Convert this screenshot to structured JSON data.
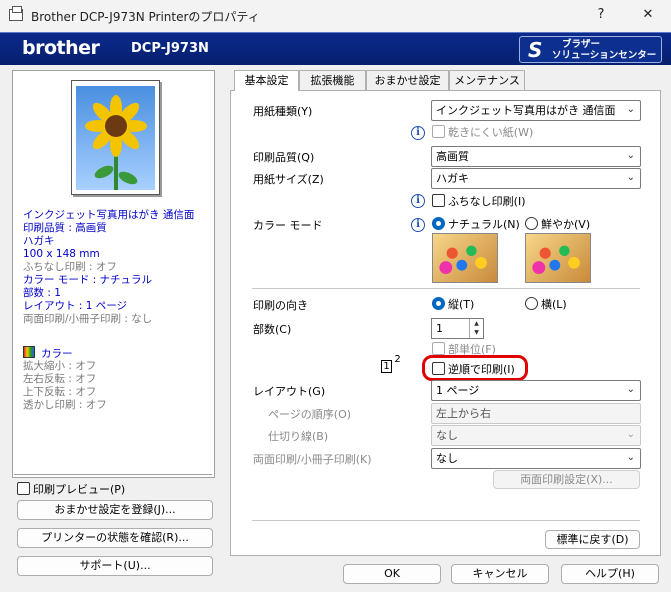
{
  "window": {
    "title": "Brother DCP-J973N Printerのプロパティ",
    "help_glyph": "?",
    "close_glyph": "✕"
  },
  "brand": {
    "logo": "brother",
    "model": "DCP-J973N",
    "solution_line1": "ブラザー",
    "solution_line2": "ソリューションセンター"
  },
  "summary": {
    "blue_lines": [
      "インクジェット写真用はがき 通信面",
      "印刷品質 : 高画質",
      "ハガキ",
      "100 x 148 mm"
    ],
    "gray_lines": [
      "ふちなし印刷 : オフ"
    ],
    "blue_lines2": [
      "カラー モード : ナチュラル",
      "部数 : 1",
      "レイアウト : 1 ページ"
    ],
    "gray_lines2": [
      "両面印刷/小冊子印刷 : なし"
    ],
    "color_label": "カラー",
    "gray_lines3": [
      "拡大縮小 : オフ",
      "左右反転 : オフ",
      "上下反転 : オフ",
      "透かし印刷 : オフ"
    ]
  },
  "left_controls": {
    "print_preview": "印刷プレビュー(P)",
    "register_favorite": "おまかせ設定を登録(J)...",
    "check_status": "プリンターの状態を確認(R)...",
    "support": "サポート(U)..."
  },
  "tabs": [
    "基本設定",
    "拡張機能",
    "おまかせ設定",
    "メンテナンス"
  ],
  "basic": {
    "media_type_label": "用紙種類(Y)",
    "media_type_value": "インクジェット写真用はがき 通信面",
    "slow_drying": "乾きにくい紙(W)",
    "quality_label": "印刷品質(Q)",
    "quality_value": "高画質",
    "paper_size_label": "用紙サイズ(Z)",
    "paper_size_value": "ハガキ",
    "borderless": "ふちなし印刷(I)",
    "color_mode_label": "カラー モード",
    "natural": "ナチュラル(N)",
    "vivid": "鮮やか(V)",
    "orientation_label": "印刷の向き",
    "portrait": "縦(T)",
    "landscape": "横(L)",
    "copies_label": "部数(C)",
    "copies_value": "1",
    "collate": "部単位(F)",
    "reverse_icon_1": "1",
    "reverse_icon_2": "2",
    "reverse_order": "逆順で印刷(I)",
    "layout_label": "レイアウト(G)",
    "layout_value": "1 ページ",
    "page_order_label": "ページの順序(O)",
    "page_order_value": "左上から右",
    "border_label": "仕切り線(B)",
    "border_value": "なし",
    "duplex_label": "両面印刷/小冊子印刷(K)",
    "duplex_value": "なし",
    "duplex_settings": "両面印刷設定(X)...",
    "default": "標準に戻す(D)"
  },
  "footer": {
    "ok": "OK",
    "cancel": "キャンセル",
    "help": "ヘルプ(H)"
  },
  "colors": {
    "brand_blue": "#0a2a8c",
    "highlight_red": "#e00000",
    "selected_radio": "#0067c0"
  }
}
